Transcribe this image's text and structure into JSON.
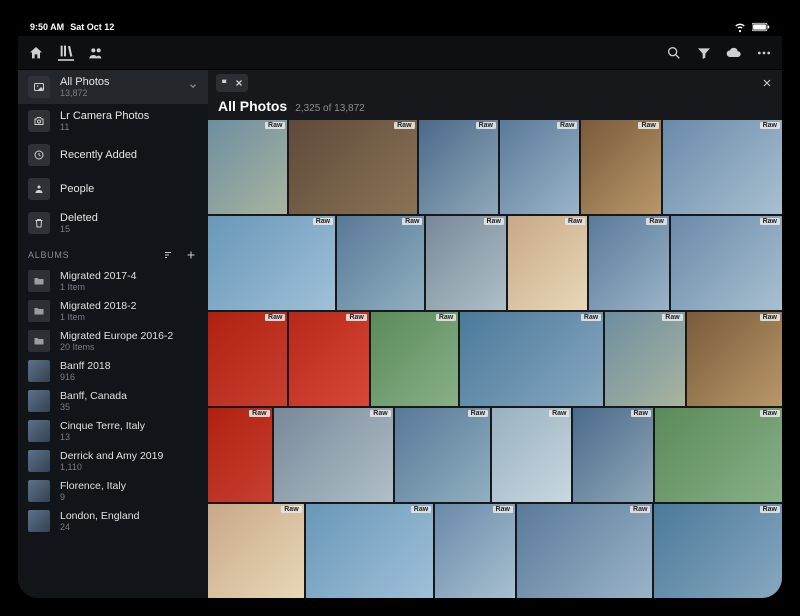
{
  "status": {
    "time": "9:50 AM",
    "date": "Sat Oct 12"
  },
  "sidebar": {
    "items": [
      {
        "title": "All Photos",
        "sub": "13,872",
        "icon": "image",
        "selected": true
      },
      {
        "title": "Lr Camera Photos",
        "sub": "11",
        "icon": "camera"
      },
      {
        "title": "Recently Added",
        "sub": "",
        "icon": "clock"
      },
      {
        "title": "People",
        "sub": "",
        "icon": "person"
      },
      {
        "title": "Deleted",
        "sub": "15",
        "icon": "trash"
      }
    ],
    "albums_header": "ALBUMS",
    "albums": [
      {
        "title": "Migrated 2017-4",
        "sub": "1 Item",
        "type": "folder"
      },
      {
        "title": "Migrated 2018-2",
        "sub": "1 Item",
        "type": "folder"
      },
      {
        "title": "Migrated Europe 2016-2",
        "sub": "20 Items",
        "type": "folder"
      },
      {
        "title": "Banff 2018",
        "sub": "916",
        "type": "photo"
      },
      {
        "title": "Banff, Canada",
        "sub": "35",
        "type": "photo"
      },
      {
        "title": "Cinque Terre, Italy",
        "sub": "13",
        "type": "photo"
      },
      {
        "title": "Derrick and Amy 2019",
        "sub": "1,110",
        "type": "photo"
      },
      {
        "title": "Florence, Italy",
        "sub": "9",
        "type": "photo"
      },
      {
        "title": "London, England",
        "sub": "24",
        "type": "photo"
      }
    ]
  },
  "main": {
    "title": "All Photos",
    "count": "2,325 of 13,872",
    "raw_label": "Raw"
  }
}
